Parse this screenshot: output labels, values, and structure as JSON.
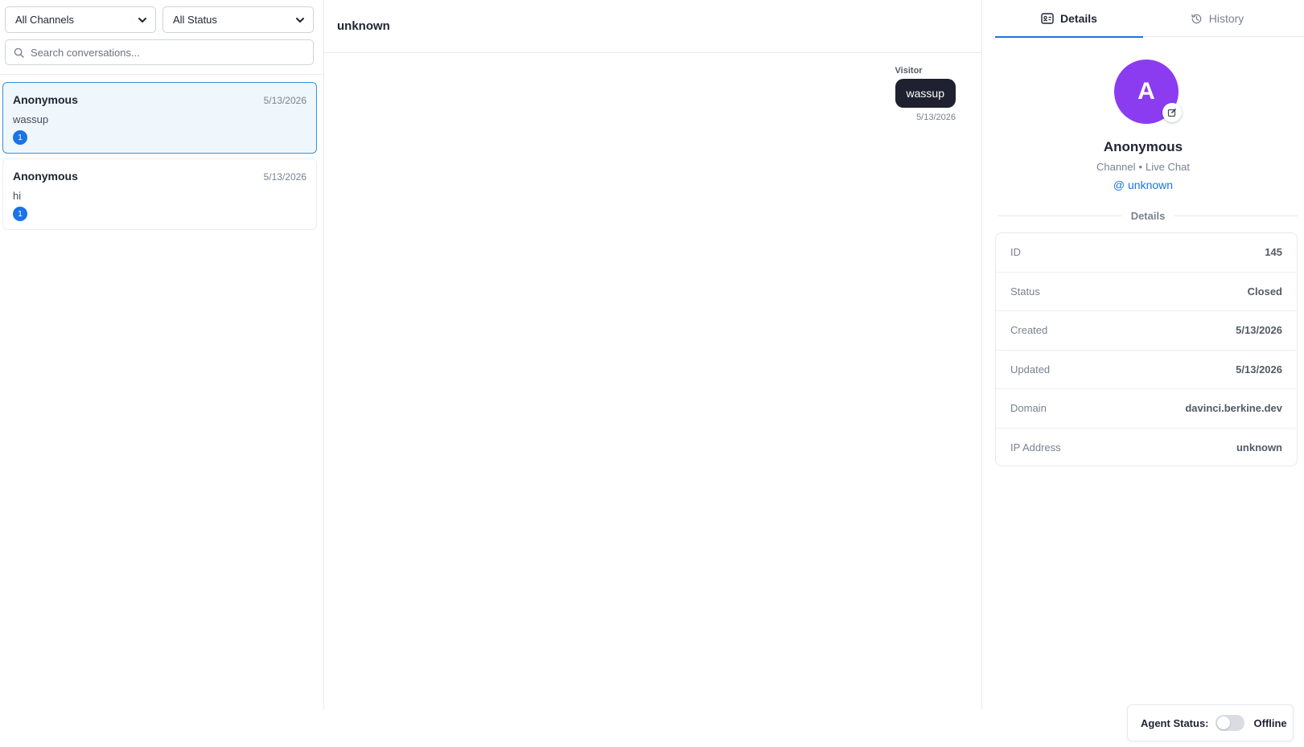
{
  "filters": {
    "channel_selected": "All Channels",
    "status_selected": "All Status"
  },
  "search": {
    "placeholder": "Search conversations..."
  },
  "conversations": [
    {
      "name": "Anonymous",
      "date": "5/13/2026",
      "preview": "wassup",
      "unread": "1",
      "active": true
    },
    {
      "name": "Anonymous",
      "date": "5/13/2026",
      "preview": "hi",
      "unread": "1",
      "active": false
    }
  ],
  "chat": {
    "title": "unknown",
    "messages": [
      {
        "sender": "Visitor",
        "text": "wassup",
        "time": "5/13/2026"
      }
    ]
  },
  "tabs": {
    "details_label": "Details",
    "history_label": "History"
  },
  "contact": {
    "initial": "A",
    "name": "Anonymous",
    "channel_label": "Channel",
    "channel_value": "Live Chat",
    "handle": "@ unknown",
    "avatar_color": "#8b3cf0"
  },
  "details": {
    "section_label": "Details",
    "rows": [
      {
        "key": "ID",
        "value": "145"
      },
      {
        "key": "Status",
        "value": "Closed"
      },
      {
        "key": "Created",
        "value": "5/13/2026"
      },
      {
        "key": "Updated",
        "value": "5/13/2026"
      },
      {
        "key": "Domain",
        "value": "davinci.berkine.dev"
      },
      {
        "key": "IP Address",
        "value": "unknown"
      }
    ]
  },
  "agent_status": {
    "label": "Agent Status:",
    "value": "Offline",
    "online": false
  },
  "colors": {
    "accent": "#1a73e8",
    "active_border": "#3a8fd6",
    "bubble": "#1f2130"
  },
  "icons": {
    "select_chevron": "chevron-down-icon",
    "search": "search-icon",
    "details_tab": "id-card-icon",
    "history_tab": "history-icon",
    "avatar_edit": "edit-icon"
  }
}
